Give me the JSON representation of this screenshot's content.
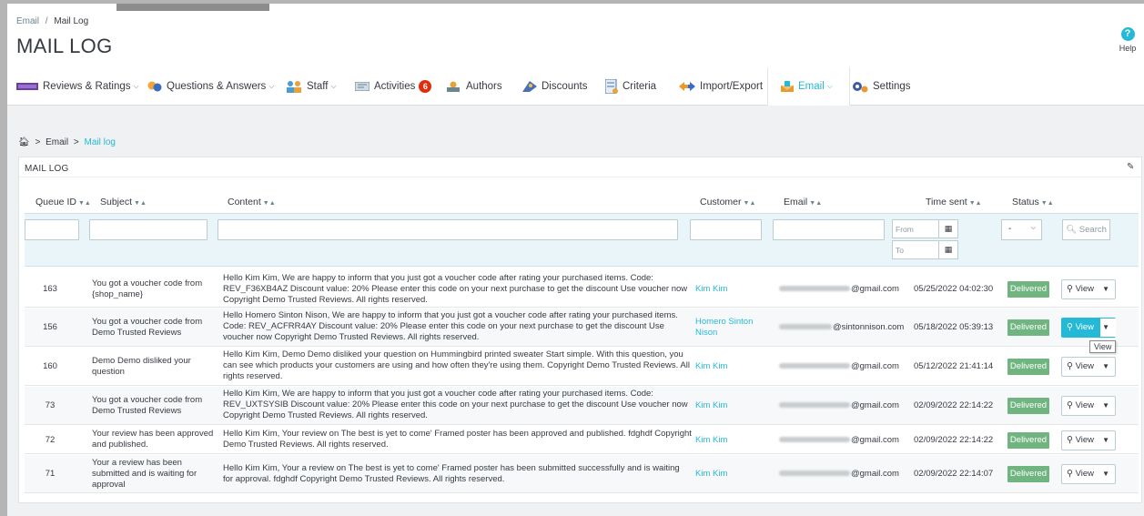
{
  "header": {
    "breadcrumb_parent": "Email",
    "breadcrumb_sep": "/",
    "breadcrumb_current": "Mail Log",
    "title": "MAIL LOG",
    "help_label": "Help",
    "help_icon": "?"
  },
  "tabs": [
    {
      "label": "Reviews & Ratings",
      "icon": "reviews-icon",
      "caret": true
    },
    {
      "label": "Questions & Answers",
      "icon": "questions-icon",
      "caret": true
    },
    {
      "label": "Staff",
      "icon": "staff-icon",
      "caret": true
    },
    {
      "label": "Activities",
      "icon": "activities-icon",
      "badge": "6"
    },
    {
      "label": "Authors",
      "icon": "authors-icon"
    },
    {
      "label": "Discounts",
      "icon": "discounts-icon"
    },
    {
      "label": "Criteria",
      "icon": "criteria-icon"
    },
    {
      "label": "Import/Export",
      "icon": "import-export-icon"
    },
    {
      "label": "Email",
      "icon": "email-icon",
      "caret": true,
      "active": true
    },
    {
      "label": "Settings",
      "icon": "settings-icon"
    }
  ],
  "content_breadcrumb": {
    "sep": ">",
    "email": "Email",
    "current": "Mail log"
  },
  "panel": {
    "title": "MAIL LOG"
  },
  "columns": {
    "queue_id": "Queue ID",
    "subject": "Subject",
    "content": "Content",
    "customer": "Customer",
    "email": "Email",
    "time_sent": "Time sent",
    "status": "Status"
  },
  "filters": {
    "date_from_placeholder": "From",
    "date_to_placeholder": "To",
    "status_value": "-",
    "search_label": "Search"
  },
  "rows": [
    {
      "id": "163",
      "subject": "You got a voucher code from {shop_name}",
      "content": "Hello Kim Kim, We are happy to inform that you just got a voucher code after rating your purchased items. Code: REV_F36XB4AZ Discount value: 20% Please enter this code on your next purchase to get the discount Use voucher now Copyright Demo Trusted Reviews. All rights reserved.",
      "customer": "Kim Kim",
      "email_domain": "@gmail.com",
      "time": "05/25/2022 04:02:30",
      "status": "Delivered",
      "view": "View"
    },
    {
      "id": "156",
      "subject": "You got a voucher code from Demo Trusted Reviews",
      "content": "Hello Homero Sinton Nison, We are happy to inform that you just got a voucher code after rating your purchased items. Code: REV_ACFRR4AY Discount value: 20% Please enter this code on your next purchase to get the discount Use voucher now Copyright Demo Trusted Reviews. All rights reserved.",
      "customer": "Homero Sinton Nison",
      "email_domain": "@sintonnison.com",
      "time": "05/18/2022 05:39:13",
      "status": "Delivered",
      "view": "View"
    },
    {
      "id": "160",
      "subject": "Demo Demo disliked your question",
      "content": "Hello Kim Kim, Demo Demo disliked your question on Hummingbird printed sweater Start simple. With this question, you can see which products your customers are using and how often they're using them. Copyright Demo Trusted Reviews. All rights reserved.",
      "customer": "Kim Kim",
      "email_domain": "@gmail.com",
      "time": "05/12/2022 21:41:14",
      "status": "Delivered",
      "view": "View"
    },
    {
      "id": "73",
      "subject": "You got a voucher code from Demo Trusted Reviews",
      "content": "Hello Kim Kim, We are happy to inform that you just got a voucher code after rating your purchased items. Code: REV_UXTSYSIB Discount value: 20% Please enter this code on your next purchase to get the discount Use voucher now Copyright Demo Trusted Reviews. All rights reserved.",
      "customer": "Kim Kim",
      "email_domain": "@gmail.com",
      "time": "02/09/2022 22:14:22",
      "status": "Delivered",
      "view": "View"
    },
    {
      "id": "72",
      "subject": "Your review has been approved and published.",
      "content": "Hello Kim Kim, Your review on The best is yet to come' Framed poster has been approved and published. fdghdf Copyright Demo Trusted Reviews. All rights reserved.",
      "customer": "Kim Kim",
      "email_domain": "@gmail.com",
      "time": "02/09/2022 22:14:22",
      "status": "Delivered",
      "view": "View"
    },
    {
      "id": "71",
      "subject": "Your a review has been submitted and is waiting for approval",
      "content": "Hello Kim Kim, Your a review on The best is yet to come' Framed poster has been submitted successfully and is waiting for approval. fdghdf Copyright Demo Trusted Reviews. All rights reserved.",
      "customer": "Kim Kim",
      "email_domain": "@gmail.com",
      "time": "02/09/2022 22:14:07",
      "status": "Delivered",
      "view": "View"
    }
  ],
  "tooltip": "View",
  "colors": {
    "accent": "#25b9d7",
    "delivered": "#70b580",
    "badge": "#e12c0d"
  }
}
